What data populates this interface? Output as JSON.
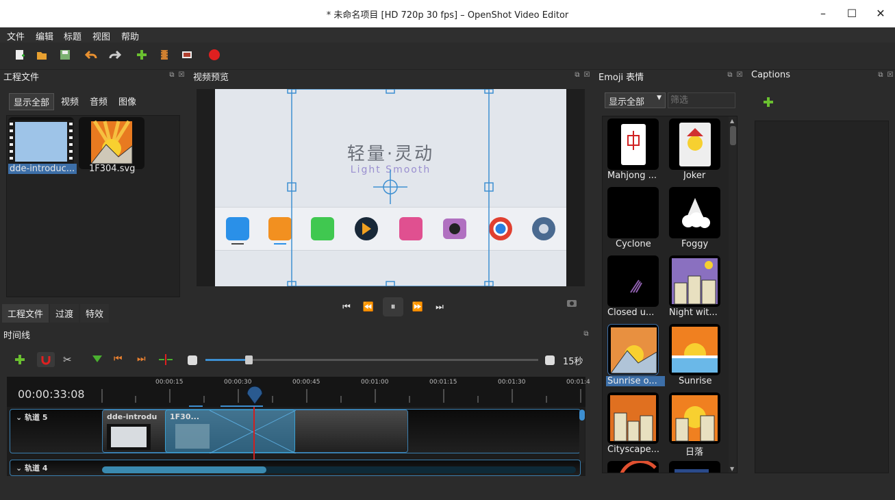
{
  "window": {
    "title": "* 未命名项目 [HD 720p 30 fps] – OpenShot Video Editor",
    "min": "–",
    "max": "☐",
    "close": "✕"
  },
  "menu": [
    "文件",
    "编辑",
    "标题",
    "视图",
    "帮助"
  ],
  "project_files": {
    "title": "工程文件",
    "filters": [
      "显示全部",
      "视频",
      "音频",
      "图像"
    ],
    "items": [
      {
        "label": "dde-introduc..."
      },
      {
        "label": "1F304.svg"
      }
    ],
    "bottom_tabs": [
      "工程文件",
      "过渡",
      "特效"
    ]
  },
  "preview": {
    "title": "视频预览",
    "headline": "轻量·灵动",
    "subline": "Light Smooth"
  },
  "emoji": {
    "title": "Emoji 表情",
    "filter_value": "显示全部",
    "search_placeholder": "筛选",
    "items": [
      {
        "label": "Mahjong ..."
      },
      {
        "label": "Joker"
      },
      {
        "label": "Cyclone"
      },
      {
        "label": "Foggy"
      },
      {
        "label": "Closed u..."
      },
      {
        "label": "Night wit..."
      },
      {
        "label": "Sunrise o..."
      },
      {
        "label": "Sunrise"
      },
      {
        "label": "Cityscape..."
      },
      {
        "label": "日落"
      }
    ]
  },
  "captions": {
    "title": "Captions"
  },
  "timeline": {
    "title": "时间线",
    "zoom_label": "15秒",
    "zoom_level": 0.1,
    "timecode": "00:00:33:08",
    "ruler": [
      "00:00:15",
      "00:00:30",
      "00:00:45",
      "00:01:00",
      "00:01:15",
      "00:01:30",
      "00:01:4"
    ],
    "tracks": [
      {
        "name": "轨道 5"
      },
      {
        "name": "轨道 4"
      }
    ],
    "clips": [
      {
        "label": "dde-introdu"
      },
      {
        "label": "1F30..."
      }
    ]
  },
  "colors": {
    "accent": "#3d8fd1",
    "playhead": "#d02020"
  }
}
